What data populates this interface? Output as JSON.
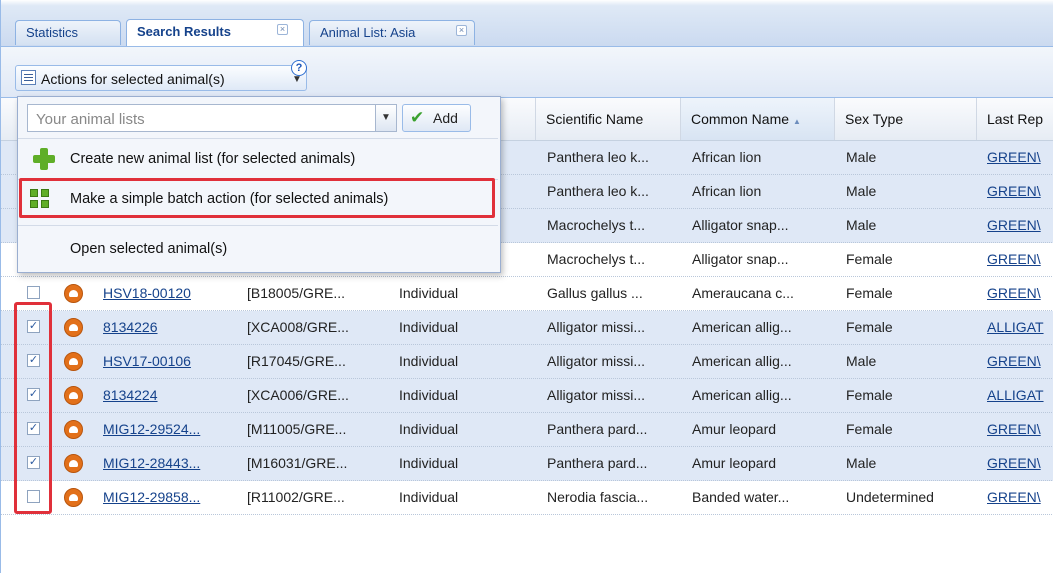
{
  "tabs": [
    {
      "label": "Statistics",
      "closable": false,
      "active": false
    },
    {
      "label": "Search Results",
      "closable": true,
      "active": true
    },
    {
      "label": "Animal List: Asia",
      "closable": true,
      "active": false
    }
  ],
  "toolbar": {
    "actions_label": "Actions for selected animal(s)",
    "help_glyph": "?"
  },
  "menu": {
    "combo_placeholder": "Your animal lists",
    "add_label": "Add",
    "items": [
      {
        "label": "Create new animal list (for selected animals)",
        "icon": "plus-icon"
      },
      {
        "label": "Make a simple batch action (for selected animals)",
        "icon": "batch-action-icon",
        "highlighted": true
      },
      {
        "label": "Open selected animal(s)",
        "icon": ""
      }
    ]
  },
  "grid": {
    "headers": {
      "scientific": "Scientific Name",
      "common": "Common Name",
      "sex": "Sex Type",
      "last": "Last Rep"
    },
    "rows": [
      {
        "checked": false,
        "selected": true,
        "id": "",
        "local": "",
        "type": "",
        "scientific": "Panthera leo k...",
        "common": "African lion",
        "sex": "Male",
        "last": "GREEN\\"
      },
      {
        "checked": false,
        "selected": true,
        "id": "",
        "local": "",
        "type": "",
        "scientific": "Panthera leo k...",
        "common": "African lion",
        "sex": "Male",
        "last": "GREEN\\"
      },
      {
        "checked": false,
        "selected": true,
        "id": "",
        "local": "",
        "type": "",
        "scientific": "Macrochelys t...",
        "common": "Alligator snap...",
        "sex": "Male",
        "last": "GREEN\\"
      },
      {
        "checked": false,
        "selected": false,
        "id": "",
        "local": "",
        "type": "",
        "scientific": "Macrochelys t...",
        "common": "Alligator snap...",
        "sex": "Female",
        "last": "GREEN\\"
      },
      {
        "checked": false,
        "selected": false,
        "id": "HSV18-00120",
        "local": "[B18005/GRE...",
        "type": "Individual",
        "scientific": "Gallus gallus ...",
        "common": "Ameraucana c...",
        "sex": "Female",
        "last": "GREEN\\"
      },
      {
        "checked": true,
        "selected": true,
        "id": "8134226",
        "local": "[XCA008/GRE...",
        "type": "Individual",
        "scientific": "Alligator missi...",
        "common": "American allig...",
        "sex": "Female",
        "last": "ALLIGAT"
      },
      {
        "checked": true,
        "selected": true,
        "id": "HSV17-00106",
        "local": "[R17045/GRE...",
        "type": "Individual",
        "scientific": "Alligator missi...",
        "common": "American allig...",
        "sex": "Male",
        "last": "GREEN\\"
      },
      {
        "checked": true,
        "selected": true,
        "id": "8134224",
        "local": "[XCA006/GRE...",
        "type": "Individual",
        "scientific": "Alligator missi...",
        "common": "American allig...",
        "sex": "Female",
        "last": "ALLIGAT"
      },
      {
        "checked": true,
        "selected": true,
        "id": "MIG12-29524...",
        "local": "[M11005/GRE...",
        "type": "Individual",
        "scientific": "Panthera pard...",
        "common": "Amur leopard",
        "sex": "Female",
        "last": "GREEN\\"
      },
      {
        "checked": true,
        "selected": true,
        "id": "MIG12-28443...",
        "local": "[M16031/GRE...",
        "type": "Individual",
        "scientific": "Panthera pard...",
        "common": "Amur leopard",
        "sex": "Male",
        "last": "GREEN\\"
      },
      {
        "checked": false,
        "selected": false,
        "id": "MIG12-29858...",
        "local": "[R11002/GRE...",
        "type": "Individual",
        "scientific": "Nerodia fascia...",
        "common": "Banded water...",
        "sex": "Undetermined",
        "last": "GREEN\\"
      }
    ]
  },
  "colors": {
    "highlight": "#e0303a",
    "selected_row": "#dfe8f6",
    "link": "#15428b",
    "animal_icon": "#e2701a"
  }
}
